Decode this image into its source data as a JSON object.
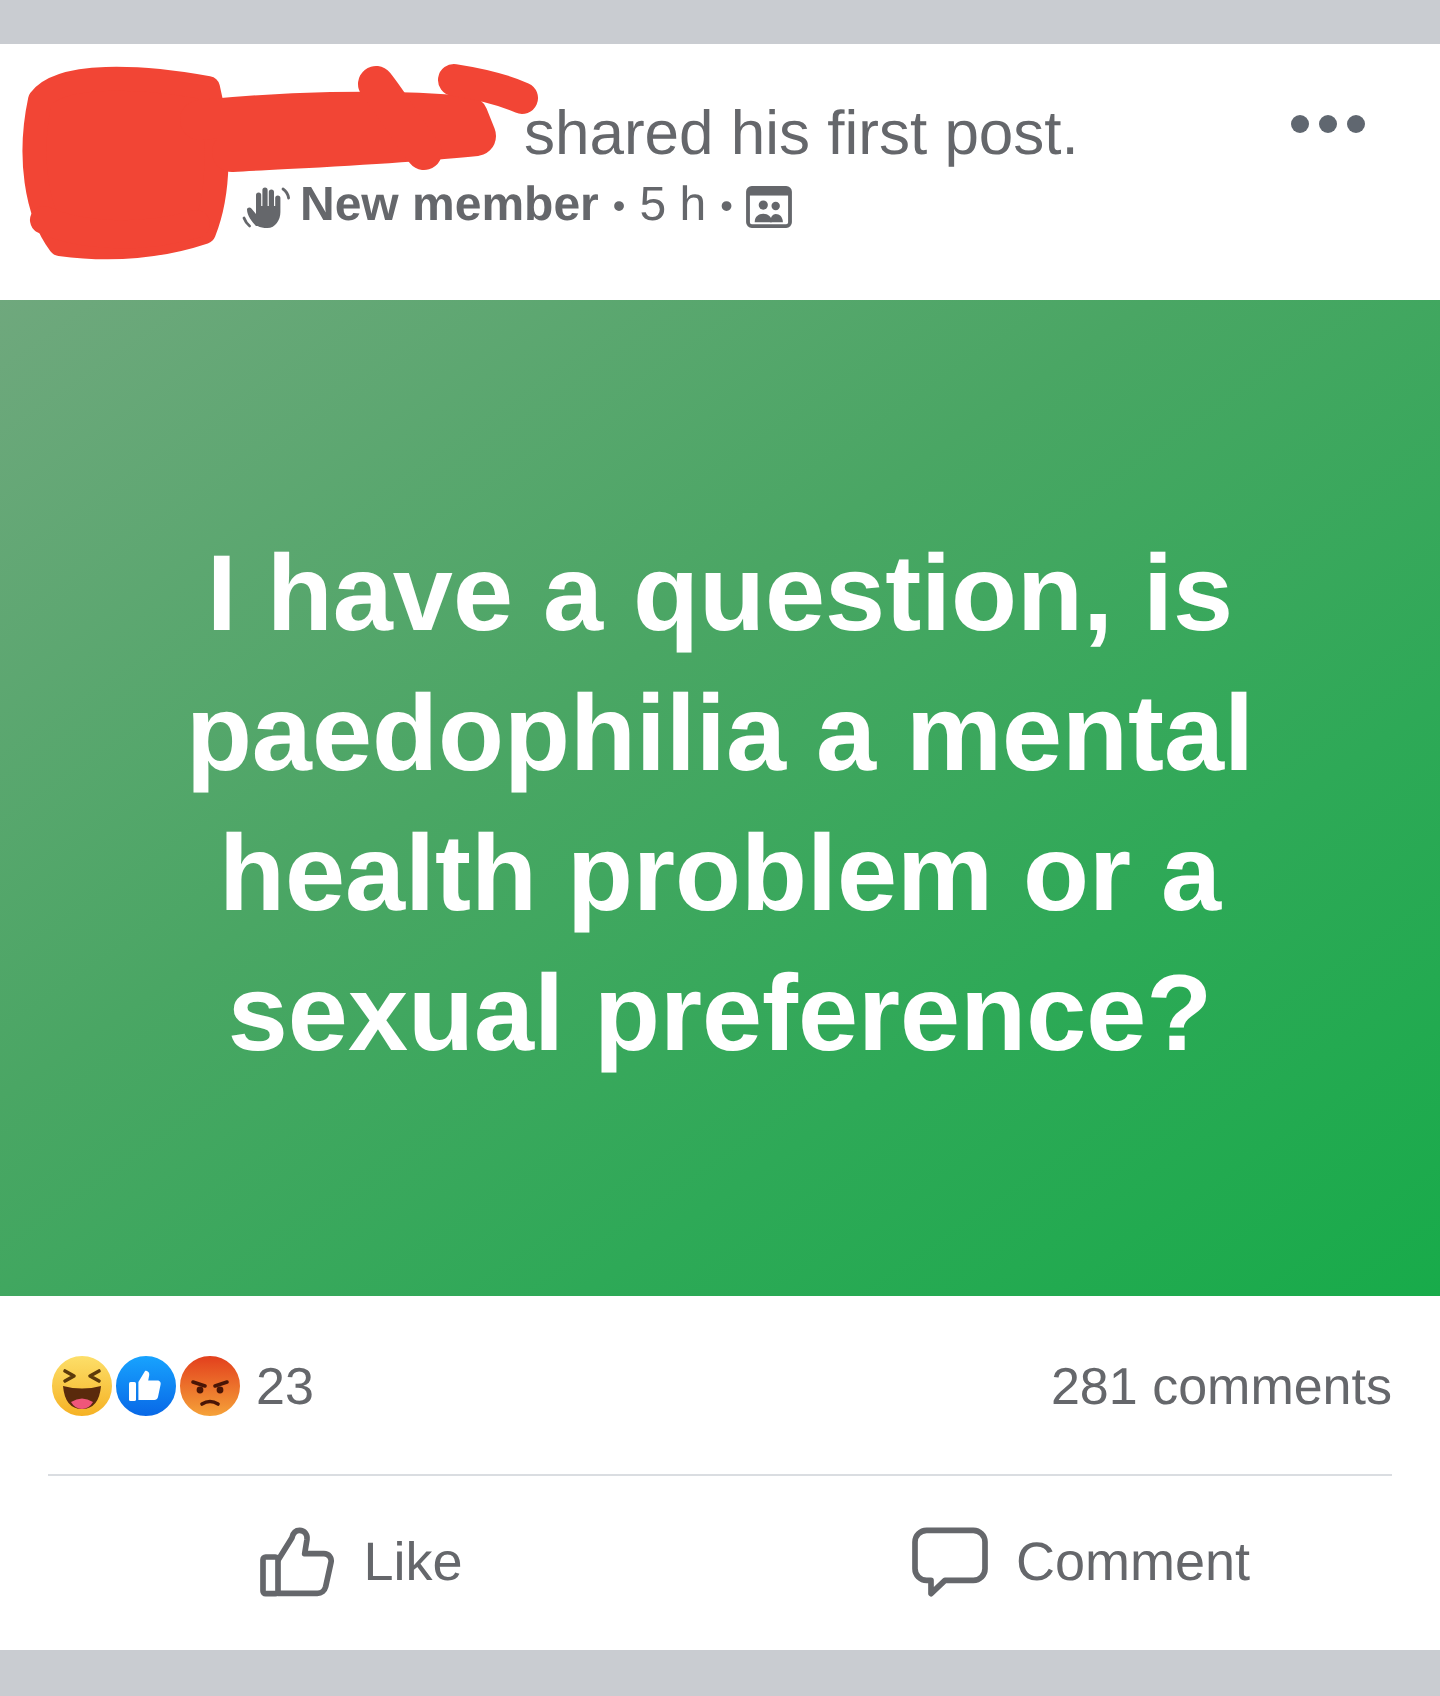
{
  "header": {
    "action": "shared his first post.",
    "badge": "New member",
    "separator_1": "•",
    "time": "5 h",
    "separator_2": "•"
  },
  "post": {
    "text": "I have a question, is paedophilia a mental health problem or a sexual preference?"
  },
  "reactions": {
    "types": [
      {
        "kind": "haha"
      },
      {
        "kind": "like"
      },
      {
        "kind": "angry"
      }
    ],
    "count": "23"
  },
  "comments_count": "281 comments",
  "actions": [
    {
      "kind": "like",
      "label": "Like"
    },
    {
      "kind": "comment",
      "label": "Comment"
    }
  ]
}
